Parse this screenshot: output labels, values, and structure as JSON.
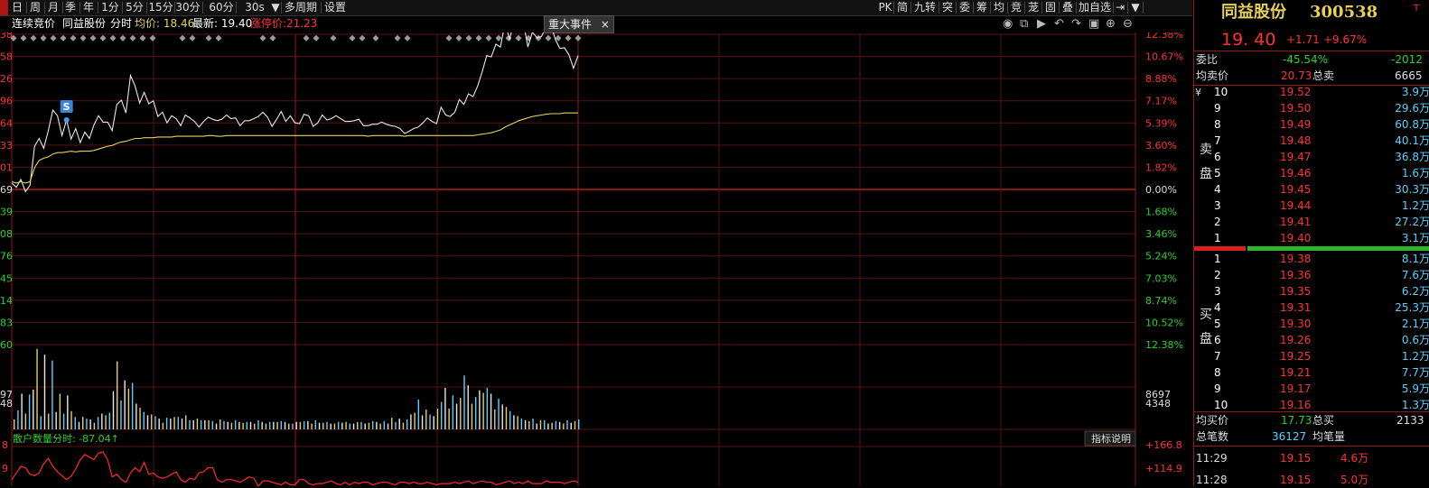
{
  "toolbar": {
    "left_items": [
      "日",
      "周",
      "月",
      "季",
      "年",
      "1分",
      "5分",
      "15分",
      "30分",
      "60分",
      "30s",
      "▼",
      "多周期",
      "设置"
    ],
    "right_items": [
      "PK",
      "简",
      "九转",
      "突",
      "委",
      "筹",
      "均",
      "竞",
      "茏",
      "固",
      "叠",
      "加自选",
      "⇥",
      "▼"
    ]
  },
  "info": {
    "auction": "连续竞价",
    "name": "同益股份",
    "mode": "分时",
    "avg_label": "均价: 18.46",
    "last_label": "最新: 19.40",
    "limit_label": "涨停价:21.23"
  },
  "event_tab": {
    "label": "重大事件",
    "close": "×"
  },
  "price_axis_left": [
    "38",
    "58",
    "26",
    "96",
    "64",
    "33",
    "01",
    "69",
    "39",
    "08",
    "76",
    "45",
    "14",
    "83",
    "60"
  ],
  "pct_axis_right": [
    "12.38%",
    "10.67%",
    "8.88%",
    "7.17%",
    "5.39%",
    "3.60%",
    "1.82%",
    "0.00%",
    "1.68%",
    "3.46%",
    "5.24%",
    "7.03%",
    "8.74%",
    "10.52%",
    "12.38%"
  ],
  "vol_axis_left": [
    "97",
    "48"
  ],
  "vol_axis_right": [
    "8697",
    "4348"
  ],
  "signal_marker": "S",
  "indicator": {
    "title": "散户数量分时: -87.04↑",
    "help_button": "指标说明",
    "axis_left": [
      "8",
      "9"
    ],
    "axis_right": [
      "+166.8",
      "+114.9"
    ]
  },
  "chart_icons": [
    "eye-icon",
    "copy-icon",
    "play-icon",
    "undo-icon",
    "redo-icon",
    "screen-icon",
    "zoom-in-icon",
    "zoom-out-icon"
  ],
  "chart_data": {
    "type": "line",
    "title": "",
    "prev_close": 17.69,
    "series": [
      {
        "name": "",
        "values": [
          17.78,
          17.72,
          17.83,
          17.66,
          17.75,
          18.3,
          18.41,
          18.27,
          18.52,
          18.81,
          18.73,
          18.45,
          18.67,
          18.4,
          18.55,
          18.35,
          18.5,
          18.41,
          18.6,
          18.73,
          18.64,
          18.64,
          18.52,
          18.89,
          18.95,
          18.77,
          19.3,
          19.15,
          18.91,
          19.06,
          18.9,
          18.94,
          18.72,
          18.78,
          18.63,
          18.73,
          18.69,
          18.59,
          18.74,
          18.7,
          18.65,
          18.57,
          18.65,
          18.71,
          18.68,
          18.66,
          18.68,
          18.74,
          18.69,
          18.7,
          18.59,
          18.66,
          18.66,
          18.69,
          18.72,
          18.78,
          18.71,
          18.58,
          18.68,
          18.79,
          18.65,
          18.73,
          18.63,
          18.62,
          18.75,
          18.73,
          18.58,
          18.63,
          18.74,
          18.67,
          18.69,
          18.73,
          18.69,
          18.65,
          18.65,
          18.66,
          18.68,
          18.59,
          18.59,
          18.61,
          18.61,
          18.64,
          18.61,
          18.59,
          18.58,
          18.55,
          18.48,
          18.51,
          18.55,
          18.57,
          18.63,
          18.7,
          18.65,
          18.62,
          18.85,
          18.74,
          18.72,
          18.78,
          18.96,
          18.89,
          19.04,
          19.0,
          19.15,
          19.35,
          19.58,
          19.56,
          19.74,
          19.7,
          20.04,
          19.81,
          20.08,
          20.1,
          20.06,
          19.7,
          19.91,
          19.83,
          19.85,
          19.99,
          20.03,
          19.81,
          19.68,
          19.69,
          19.59,
          19.4,
          19.58
        ]
      },
      {
        "name": "",
        "values": [
          17.8,
          17.78,
          17.8,
          17.78,
          17.8,
          18.0,
          18.1,
          18.13,
          18.15,
          18.19,
          18.21,
          18.21,
          18.22,
          18.23,
          18.22,
          18.23,
          18.23,
          18.23,
          18.24,
          18.26,
          18.28,
          18.3,
          18.31,
          18.34,
          18.36,
          18.37,
          18.39,
          18.41,
          18.41,
          18.42,
          18.42,
          18.42,
          18.43,
          18.43,
          18.43,
          18.43,
          18.44,
          18.44,
          18.44,
          18.44,
          18.44,
          18.44,
          18.44,
          18.45,
          18.45,
          18.44,
          18.44,
          18.45,
          18.45,
          18.45,
          18.45,
          18.45,
          18.45,
          18.45,
          18.45,
          18.45,
          18.45,
          18.45,
          18.45,
          18.45,
          18.45,
          18.45,
          18.45,
          18.45,
          18.45,
          18.45,
          18.45,
          18.45,
          18.45,
          18.45,
          18.45,
          18.45,
          18.45,
          18.45,
          18.45,
          18.45,
          18.45,
          18.45,
          18.44,
          18.45,
          18.45,
          18.45,
          18.45,
          18.45,
          18.45,
          18.45,
          18.44,
          18.45,
          18.45,
          18.45,
          18.45,
          18.45,
          18.45,
          18.45,
          18.45,
          18.45,
          18.45,
          18.45,
          18.45,
          18.45,
          18.45,
          18.45,
          18.46,
          18.47,
          18.48,
          18.49,
          18.51,
          18.53,
          18.57,
          18.6,
          18.63,
          18.66,
          18.68,
          18.7,
          18.72,
          18.73,
          18.74,
          18.75,
          18.76,
          18.76,
          18.76,
          18.77,
          18.77,
          18.77,
          18.77
        ]
      }
    ],
    "volume": [
      1200,
      2300,
      4300,
      1900,
      4200,
      4800,
      9700,
      1600,
      9000,
      1900,
      8300,
      2100,
      4300,
      1900,
      4100,
      2200,
      1500,
      900,
      1500,
      1300,
      1200,
      800,
      1500,
      1900,
      1700,
      2000,
      4600,
      8200,
      3500,
      5900,
      4900,
      5600,
      3100,
      2600,
      2100,
      1700,
      1800,
      1600,
      1300,
      800,
      1400,
      1300,
      1500,
      1500,
      1300,
      1700,
      1100,
      1100,
      1300,
      1100,
      1100,
      1100,
      1000,
      700,
      1200,
      1000,
      900,
      800,
      1100,
      900,
      800,
      900,
      900,
      700,
      1100,
      900,
      700,
      900,
      900,
      900,
      1000,
      900,
      700,
      700,
      900,
      900,
      1000,
      1000,
      700,
      1100,
      800,
      800,
      900,
      700,
      700,
      900,
      800,
      900,
      700,
      700,
      900,
      900,
      700,
      800,
      1000,
      900,
      700,
      1000,
      700,
      1400,
      900,
      1300,
      800,
      1200,
      1800,
      2000,
      3600,
      1700,
      2400,
      1800,
      1600,
      2500,
      3300,
      5000,
      2500,
      4100,
      3100,
      3800,
      6500,
      5300,
      3100,
      3900,
      4700,
      4400,
      5000,
      4300,
      2400,
      3700,
      3000,
      2700,
      2200,
      1700,
      1600,
      1300,
      1100,
      1000,
      1300,
      700,
      1100,
      1100,
      700,
      800,
      1000,
      900,
      700,
      1100,
      800,
      1000,
      1200
    ],
    "indicator_series": [
      100,
      110,
      120,
      118,
      108,
      106,
      110,
      124,
      132,
      120,
      112,
      106,
      100,
      105,
      116,
      130,
      138,
      134,
      130,
      140,
      142,
      130,
      104,
      108,
      100,
      96,
      110,
      118,
      112,
      126,
      108,
      110,
      104,
      102,
      104,
      108,
      112,
      100,
      96,
      102,
      100,
      110,
      112,
      118,
      118,
      100,
      96,
      100,
      100,
      98,
      96,
      100,
      104,
      102,
      90,
      98,
      98,
      96,
      94,
      92,
      96,
      92,
      92,
      100,
      100,
      94,
      92,
      94,
      94,
      96,
      98,
      94,
      92,
      96,
      92,
      96,
      94,
      96,
      96,
      92,
      94,
      96,
      96,
      94,
      92,
      96,
      96,
      94,
      96,
      94,
      94,
      96,
      94,
      92,
      94,
      94,
      94,
      96,
      94,
      96,
      98,
      94,
      96,
      98,
      96,
      96,
      92,
      94,
      96,
      98,
      94,
      96,
      94,
      98,
      94,
      94,
      94,
      98,
      96,
      96,
      96,
      94,
      96,
      98,
      96
    ],
    "ylim": [
      15.51,
      19.88
    ],
    "limit_up": 21.23
  },
  "panel": {
    "title": "同益股份",
    "code": "300538",
    "corner_marker": "T",
    "price": "19. 40",
    "change": "+1.71",
    "change_pct": "+9.67%",
    "webi_label": "委比",
    "webi_pct": "-45.54%",
    "webi_val": "-2012",
    "avg_sell_label": "均卖价",
    "avg_sell": "20.73",
    "total_sell_label": "总卖",
    "total_sell": "6665",
    "sell_side_label": "卖盘",
    "buy_side_label": "买盘",
    "currency": "¥",
    "asks": [
      {
        "level": "10",
        "price": "19.52",
        "vol": "3.9万"
      },
      {
        "level": "9",
        "price": "19.50",
        "vol": "29.6万"
      },
      {
        "level": "8",
        "price": "19.49",
        "vol": "60.8万"
      },
      {
        "level": "7",
        "price": "19.48",
        "vol": "40.1万"
      },
      {
        "level": "6",
        "price": "19.47",
        "vol": "36.8万"
      },
      {
        "level": "5",
        "price": "19.46",
        "vol": "1.6万"
      },
      {
        "level": "4",
        "price": "19.45",
        "vol": "30.3万"
      },
      {
        "level": "3",
        "price": "19.44",
        "vol": "1.2万"
      },
      {
        "level": "2",
        "price": "19.41",
        "vol": "27.2万"
      },
      {
        "level": "1",
        "price": "19.40",
        "vol": "3.1万"
      }
    ],
    "bids": [
      {
        "level": "1",
        "price": "19.38",
        "vol": "8.1万"
      },
      {
        "level": "2",
        "price": "19.36",
        "vol": "7.6万"
      },
      {
        "level": "3",
        "price": "19.35",
        "vol": "6.2万"
      },
      {
        "level": "4",
        "price": "19.31",
        "vol": "25.3万"
      },
      {
        "level": "5",
        "price": "19.30",
        "vol": "2.1万"
      },
      {
        "level": "6",
        "price": "19.26",
        "vol": "0.6万"
      },
      {
        "level": "7",
        "price": "19.25",
        "vol": "1.2万"
      },
      {
        "level": "8",
        "price": "19.21",
        "vol": "7.7万"
      },
      {
        "level": "9",
        "price": "19.17",
        "vol": "5.9万"
      },
      {
        "level": "10",
        "price": "19.16",
        "vol": "1.3万"
      }
    ],
    "avg_buy_label": "均买价",
    "avg_buy": "17.73",
    "total_buy_label": "总买",
    "total_buy": "2133",
    "trades_label": "总笔数",
    "trades": "36127",
    "avg_trade_label": "均笔量",
    "ticks": [
      {
        "time": "11:29",
        "price": "19.15",
        "vol": "4.6万"
      },
      {
        "time": "11:28",
        "price": "19.15",
        "vol": "5.0万"
      }
    ]
  }
}
